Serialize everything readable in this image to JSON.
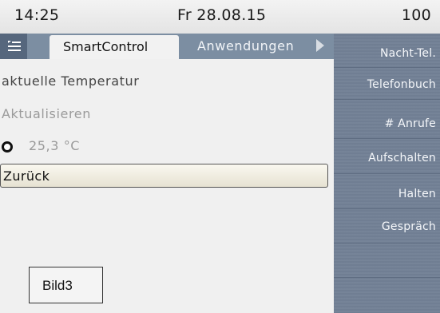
{
  "status_bar": {
    "time": "14:25",
    "date": "Fr 28.08.15",
    "extension": "100"
  },
  "tabs": {
    "menu_icon": "menu-list-icon",
    "active": "SmartControl",
    "inactive": "Anwendungen",
    "more_icon": "arrow-right-icon"
  },
  "content": {
    "title": "aktuelle Temperatur",
    "refresh": "Aktualisieren",
    "temperature": "25,3 °C",
    "back": "Zurück"
  },
  "function_keys": [
    "Nacht-Tel.",
    "Telefonbuch",
    "# Anrufe",
    "Aufschalten",
    "Halten",
    "Gespräch"
  ],
  "caption": "Bild3",
  "colors": {
    "tabbar": "#7c8ea2",
    "function_panel": "#79879b"
  }
}
